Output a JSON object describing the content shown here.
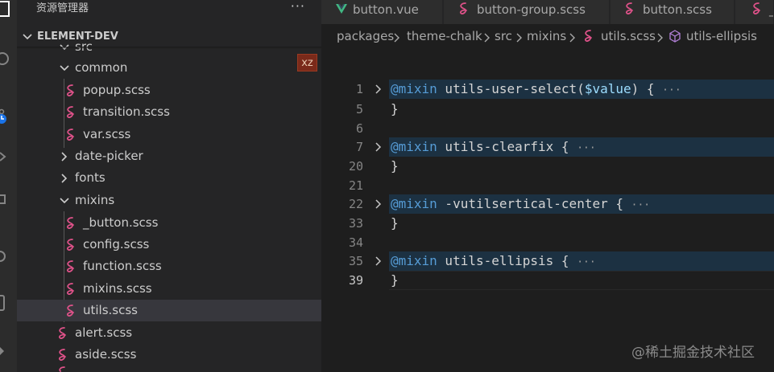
{
  "sidebar": {
    "title": "资源管理器",
    "more": "···",
    "project": "ELEMENT-DEV",
    "badge": "xz",
    "items": [
      {
        "label": "src",
        "type": "folder",
        "depth": 1,
        "expanded": true
      },
      {
        "label": "common",
        "type": "folder",
        "depth": 2,
        "expanded": true
      },
      {
        "label": "popup.scss",
        "type": "scss",
        "depth": 3
      },
      {
        "label": "transition.scss",
        "type": "scss",
        "depth": 3
      },
      {
        "label": "var.scss",
        "type": "scss",
        "depth": 3
      },
      {
        "label": "date-picker",
        "type": "folder",
        "depth": 2,
        "expanded": false
      },
      {
        "label": "fonts",
        "type": "folder",
        "depth": 2,
        "expanded": false
      },
      {
        "label": "mixins",
        "type": "folder",
        "depth": 2,
        "expanded": true
      },
      {
        "label": "_button.scss",
        "type": "scss",
        "depth": 3
      },
      {
        "label": "config.scss",
        "type": "scss",
        "depth": 3
      },
      {
        "label": "function.scss",
        "type": "scss",
        "depth": 3
      },
      {
        "label": "mixins.scss",
        "type": "scss",
        "depth": 3
      },
      {
        "label": "utils.scss",
        "type": "scss",
        "depth": 3,
        "selected": true
      },
      {
        "label": "alert.scss",
        "type": "scss",
        "depth": 2
      },
      {
        "label": "aside.scss",
        "type": "scss",
        "depth": 2
      }
    ]
  },
  "tabs": [
    {
      "label": "button.vue",
      "icon": "vue-icon"
    },
    {
      "label": "button-group.scss",
      "icon": "sass-icon"
    },
    {
      "label": "button.scss",
      "icon": "sass-icon"
    },
    {
      "label": "_",
      "icon": "sass-icon"
    }
  ],
  "breadcrumbs": {
    "parts": [
      "packages",
      "theme-chalk",
      "src",
      "mixins",
      "utils.scss",
      "utils-ellipsis"
    ]
  },
  "editor": {
    "lines": [
      {
        "num": "1",
        "kw": "@mixin",
        "rest": " utils-user-select(",
        "var": "$value",
        "tail": ") {",
        "folded": true
      },
      {
        "num": "5",
        "text": "}"
      },
      {
        "num": "6",
        "text": ""
      },
      {
        "num": "7",
        "kw": "@mixin",
        "rest": " utils-clearfix {",
        "folded": true
      },
      {
        "num": "20",
        "text": "}"
      },
      {
        "num": "21",
        "text": ""
      },
      {
        "num": "22",
        "kw": "@mixin",
        "rest": " -vutilsertical-center {",
        "folded": true
      },
      {
        "num": "33",
        "text": "}"
      },
      {
        "num": "34",
        "text": ""
      },
      {
        "num": "35",
        "kw": "@mixin",
        "rest": " utils-ellipsis {",
        "folded": true
      },
      {
        "num": "39",
        "text": "}",
        "current": true
      }
    ],
    "ellipsis": "···"
  },
  "watermark": "@稀土掘金技术社区",
  "colors": {
    "sass": "#e0528a",
    "keyword": "#569cd6",
    "variable": "#9cdcfe",
    "fold_highlight": "#1c3142",
    "vue": "#41b883"
  }
}
